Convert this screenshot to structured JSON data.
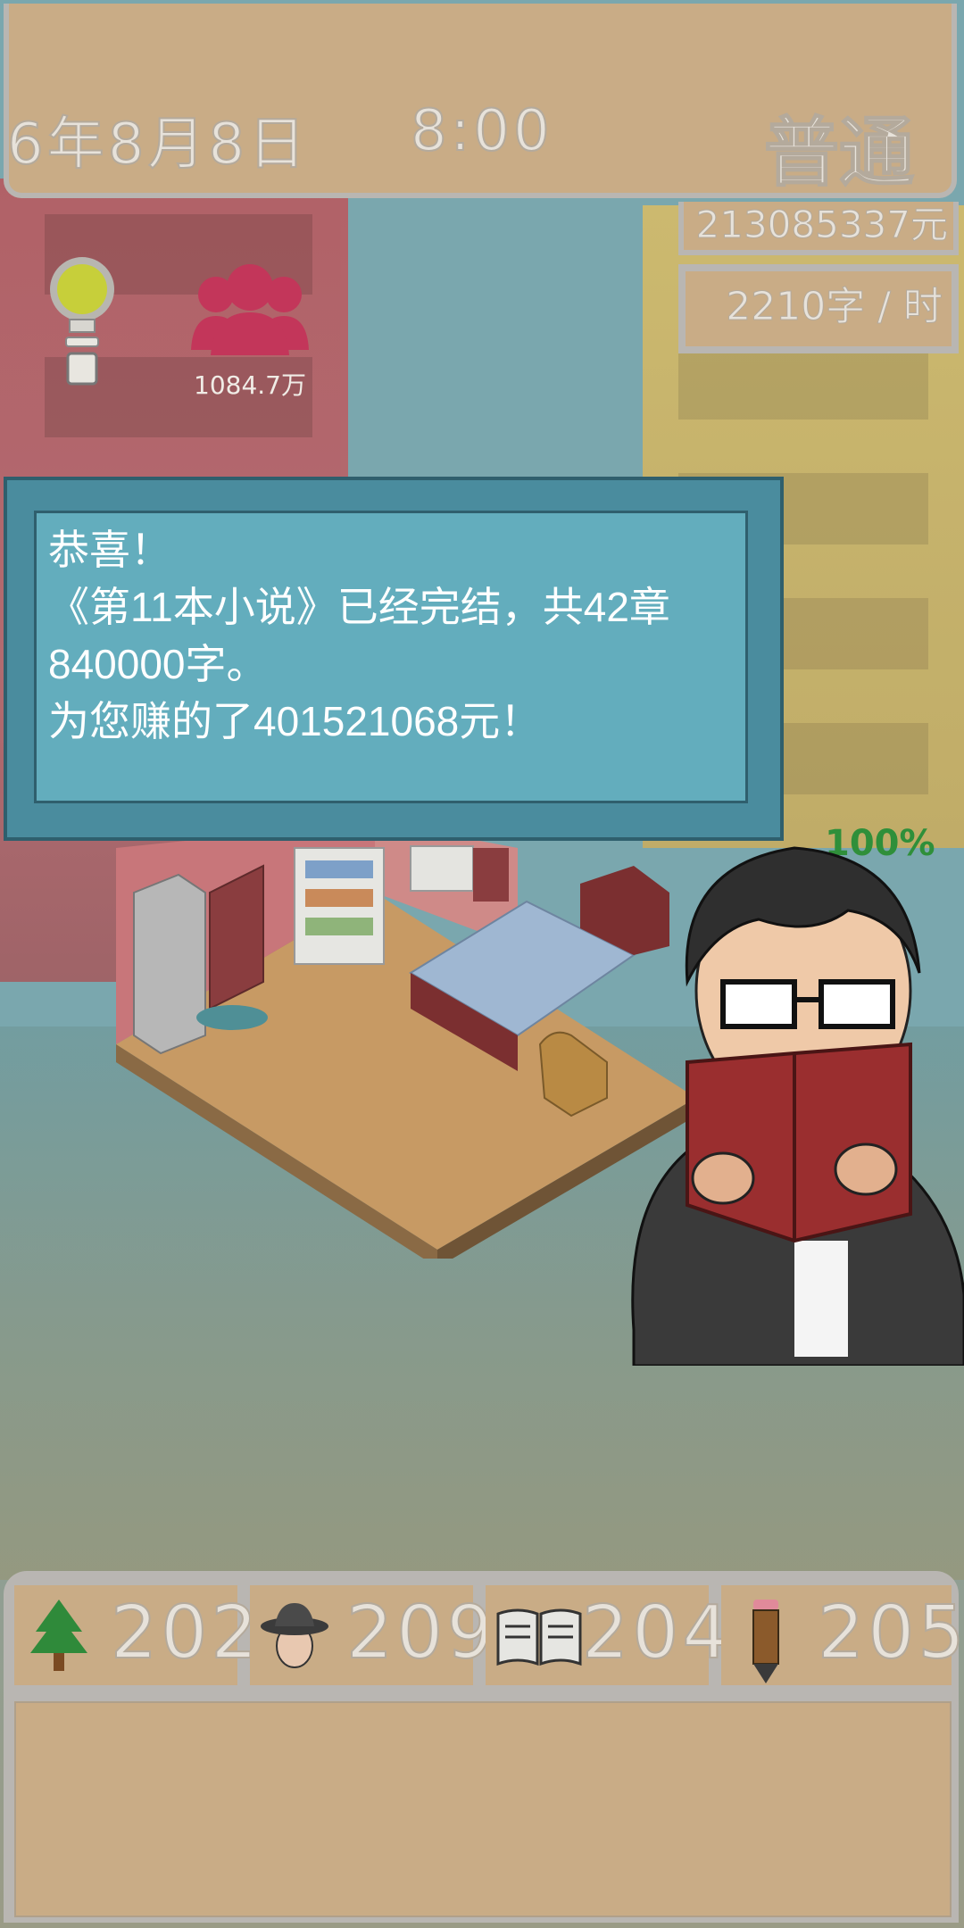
{
  "header": {
    "date": "6年8月8日",
    "time": "8:00",
    "speed": "普通"
  },
  "stats_panel": {
    "money": "213085337元",
    "rate": "2210字 / 时",
    "fans": "1084.7万"
  },
  "dialog": {
    "line1": "恭喜！",
    "line2": "《第11本小说》已经完结，共42章",
    "line3": "840000字。",
    "line4": "为您赚的了401521068元！"
  },
  "progress_percent": "100%",
  "attributes": [
    {
      "icon": "tree-icon",
      "value": "202"
    },
    {
      "icon": "detective-hat-icon",
      "value": "209"
    },
    {
      "icon": "open-book-icon",
      "value": "204"
    },
    {
      "icon": "pencil-icon",
      "value": "205"
    }
  ],
  "colors": {
    "panel": "#c9ac86",
    "border": "#b9b6b2",
    "dialog": "#63adbd",
    "fans": "#c3365a",
    "progress": "#2f8f3a"
  }
}
